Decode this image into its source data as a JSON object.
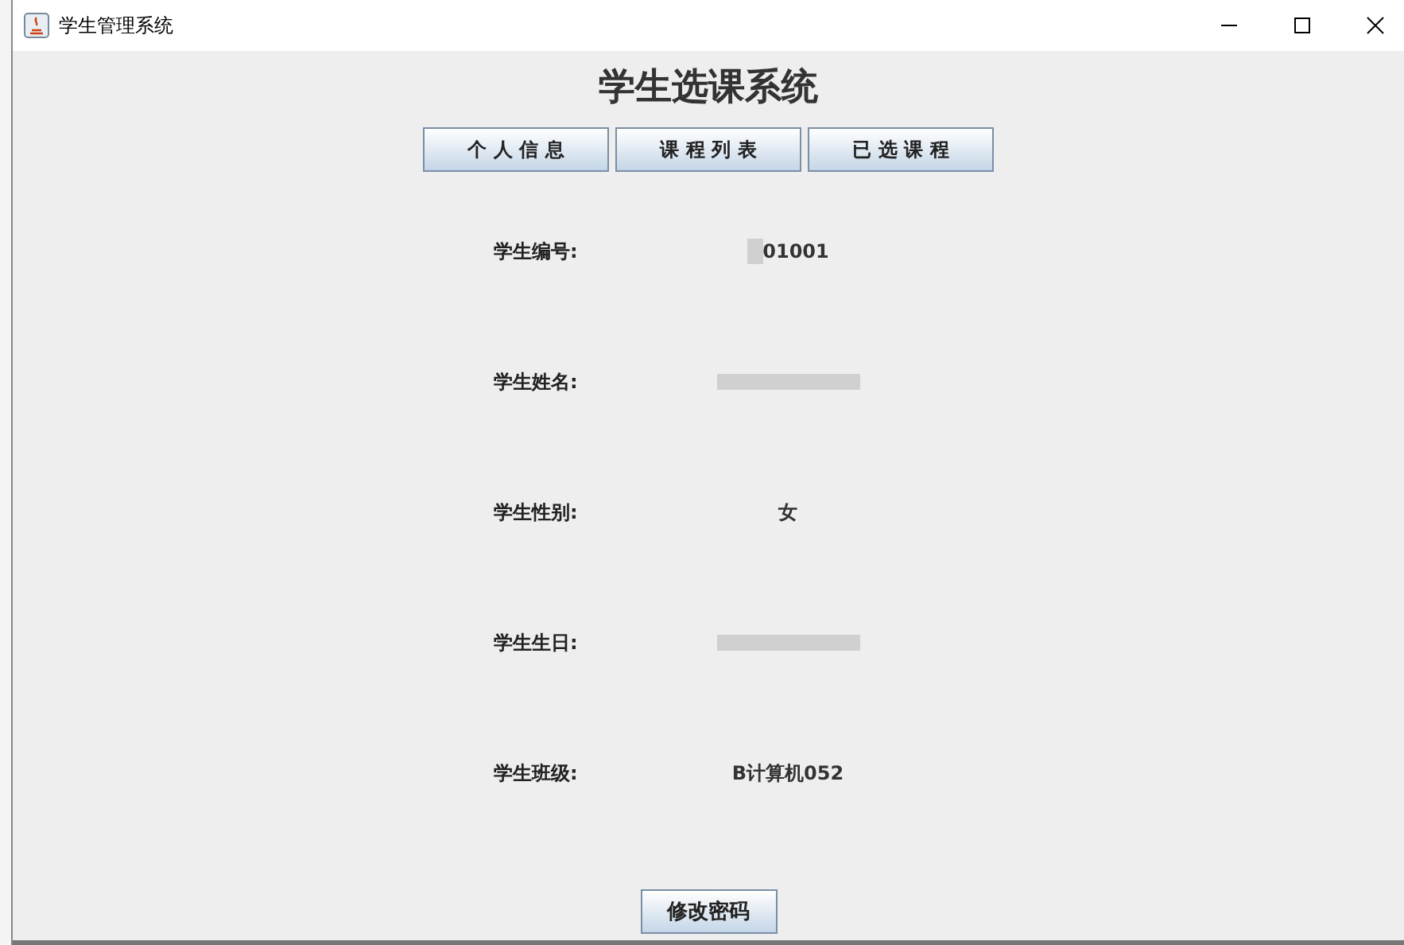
{
  "window": {
    "title": "学生管理系统"
  },
  "header": {
    "title": "学生选课系统"
  },
  "tabs": [
    {
      "label": "个 人 信 息"
    },
    {
      "label": "课 程 列 表"
    },
    {
      "label": "已 选 课 程"
    }
  ],
  "fields": [
    {
      "label": "学生编号:",
      "value": "01001",
      "kind": "partly_blurred"
    },
    {
      "label": "学生姓名:",
      "kind": "blurred"
    },
    {
      "label": "学生性别:",
      "value": "女",
      "kind": "text"
    },
    {
      "label": "学生生日:",
      "kind": "blurred"
    },
    {
      "label": "学生班级:",
      "value": "B计算机052",
      "kind": "text"
    }
  ],
  "footer": {
    "button": "修改密码"
  }
}
